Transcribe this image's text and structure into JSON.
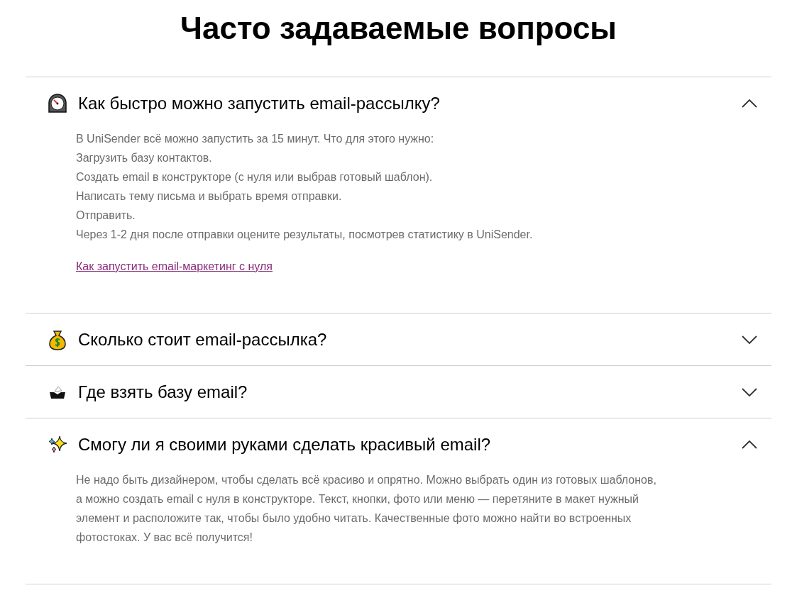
{
  "title": "Часто задаваемые вопросы",
  "faq": [
    {
      "question": "Как быстро можно запустить email-рассылку?",
      "expanded": true,
      "lines": [
        "В UniSender всё можно запустить за 15 минут. Что для этого нужно:",
        "Загрузить базу контактов.",
        "Создать email в конструкторе (с нуля или выбрав готовый шаблон).",
        "Написать тему письма и выбрать время отправки.",
        "Отправить.",
        "Через 1-2 дня после отправки оцените результаты, посмотрев статистику в UniSender."
      ],
      "link": "Как запустить email-маркетинг с нуля"
    },
    {
      "question": "Сколько стоит email-рассылка?",
      "expanded": false
    },
    {
      "question": "Где взять базу email?",
      "expanded": false
    },
    {
      "question": "Смогу ли я своими руками сделать красивый email?",
      "expanded": true,
      "paragraph": "Не надо быть дизайнером, чтобы сделать всё красиво и опрятно. Можно выбрать один из готовых шаблонов, а можно создать email с нуля в конструкторе. Текст, кнопки, фото или меню — перетяните в макет нужный элемент и расположите так, чтобы было удобно читать. Качественные фото можно найти во встроенных фотостоках. У вас всё получится!"
    }
  ]
}
